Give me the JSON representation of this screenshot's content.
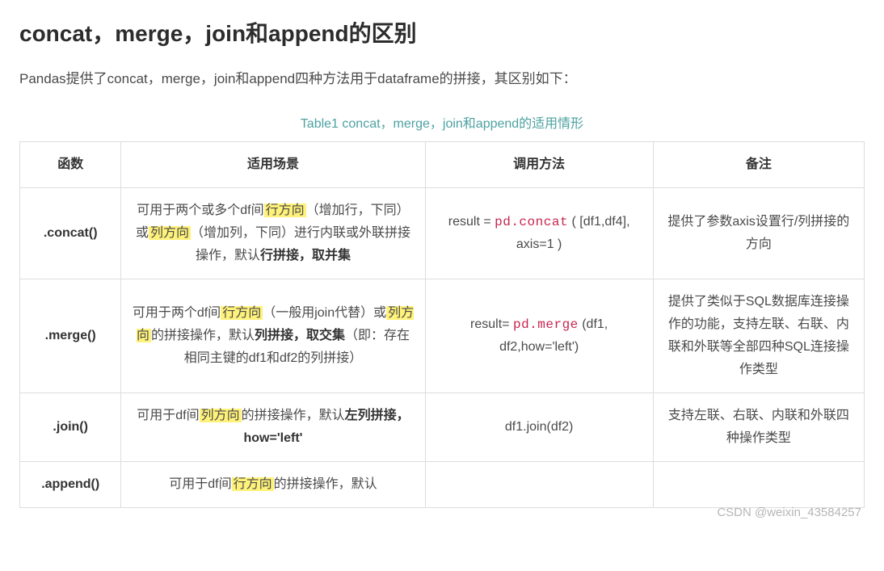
{
  "title": "concat，merge，join和append的区别",
  "intro": "Pandas提供了concat，merge，join和append四种方法用于dataframe的拼接，其区别如下：",
  "table_caption": "Table1 concat，merge，join和append的适用情形",
  "headers": {
    "func": "函数",
    "scene": "适用场景",
    "call": "调用方法",
    "note": "备注"
  },
  "rows": {
    "concat": {
      "func": ".concat()",
      "scene_p1": "可用于两个或多个df间",
      "scene_hl1": "行方向",
      "scene_p2": "（增加行，下同）或",
      "scene_hl2": "列方向",
      "scene_p3": "（增加列，下同）进行内联或外联拼接操作，默认",
      "scene_strong": "行拼接，取并集",
      "call_pre": "result = ",
      "call_code": "pd.concat",
      "call_post": " ( [df1,df4], axis=1 )",
      "note": "提供了参数axis设置行/列拼接的方向"
    },
    "merge": {
      "func": ".merge()",
      "scene_p1": "可用于两个df间",
      "scene_hl1": "行方向",
      "scene_p2": "（一般用join代替）或",
      "scene_hl2": "列方向",
      "scene_p3": "的拼接操作，默认",
      "scene_strong": "列拼接，取交集",
      "scene_p4": "（即：存在相同主键的df1和df2的列拼接）",
      "call_pre": "result= ",
      "call_code": "pd.merge",
      "call_post": " (df1, df2,how='left')",
      "note": "提供了类似于SQL数据库连接操作的功能，支持左联、右联、内联和外联等全部四种SQL连接操作类型"
    },
    "join": {
      "func": ".join()",
      "scene_p1": "可用于df间",
      "scene_hl1": "列方向",
      "scene_p2": "的拼接操作，默认",
      "scene_strong": "左列拼接，how='left'",
      "call": "df1.join(df2)",
      "note": "支持左联、右联、内联和外联四种操作类型"
    },
    "append": {
      "func": ".append()",
      "scene_p1": "可用于df间",
      "scene_hl1": "行方向",
      "scene_p2": "的拼接操作，默认"
    }
  },
  "watermark": "CSDN @weixin_43584257"
}
